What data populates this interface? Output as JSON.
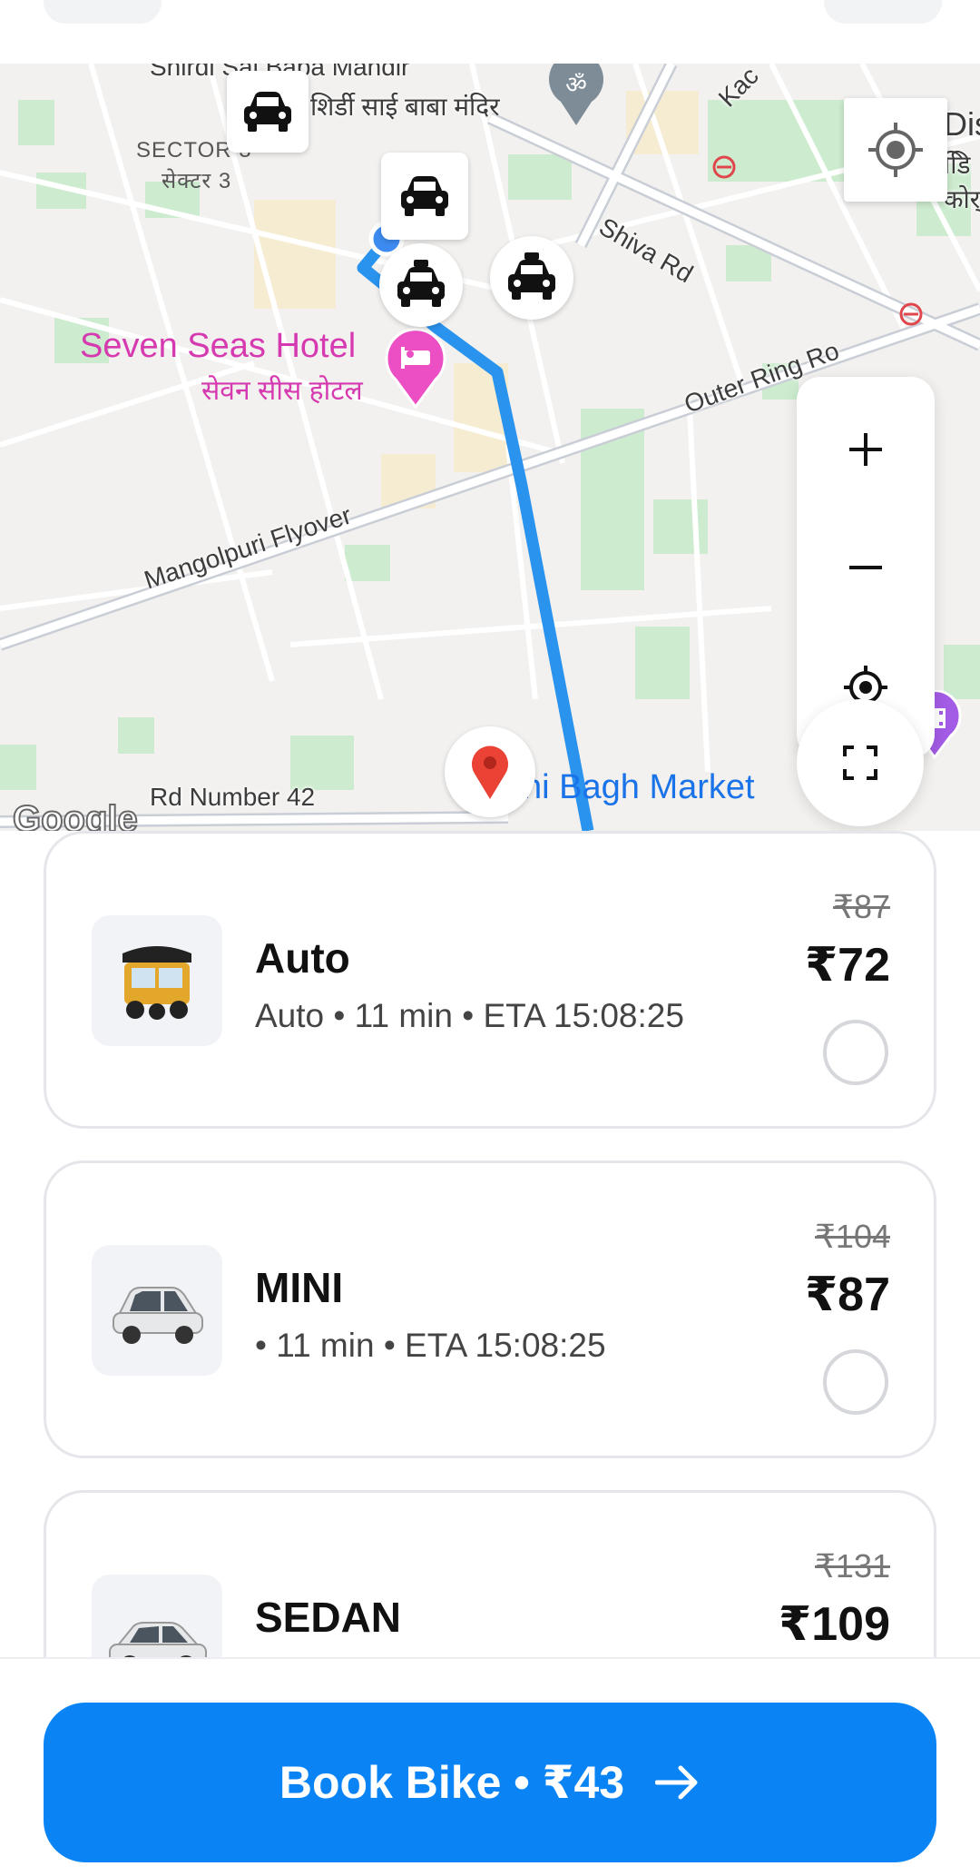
{
  "map": {
    "labels": {
      "temple_en": "Shirdi Sai Baba Mandir",
      "temple_hi": "शिर्डी साई बाबा मंदिर",
      "sector_en": "SECTOR 3",
      "sector_hi": "सेक्टर 3",
      "shiva_rd": "Shiva Rd",
      "outer_ring": "Outer Ring Ro",
      "hotel_en": "Seven Seas Hotel",
      "hotel_hi": "सेवन सीस होटल",
      "flyover": "Mangolpuri Flyover",
      "rd42": "Rd Number 42",
      "market": "ni Bagh Market",
      "top_right": "Dis",
      "top_right_hi1": "डिि",
      "top_right_hi2": "कोर्",
      "kac": "Kac"
    },
    "watermark": "Google",
    "icons": [
      "car-icon",
      "taxi-icon",
      "hotel-pin-icon",
      "temple-pin-icon",
      "destination-pin-icon",
      "cinema-pin-icon",
      "metro-icon"
    ]
  },
  "map_controls": {
    "icons": [
      "gps-locate-icon",
      "zoom-in-icon",
      "zoom-out-icon",
      "recenter-icon",
      "fullscreen-icon"
    ]
  },
  "rides": [
    {
      "name": "Auto",
      "meta": "Auto • 11 min • ETA 15:08:25",
      "old_price": "₹87",
      "price": "₹72",
      "image": "auto-rickshaw-image"
    },
    {
      "name": "MINI",
      "meta": " • 11 min • ETA 15:08:25",
      "old_price": "₹104",
      "price": "₹87",
      "image": "hatchback-car-image"
    },
    {
      "name": "SEDAN",
      "meta": "",
      "old_price": "₹131",
      "price": "₹109",
      "image": "sedan-car-image"
    }
  ],
  "footer": {
    "book_label": "Book Bike • ₹43",
    "accent_color": "#0a84f5"
  }
}
